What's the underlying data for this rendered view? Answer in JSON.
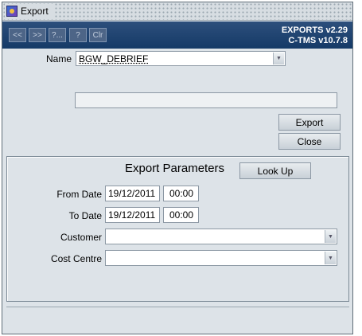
{
  "window": {
    "title": "Export"
  },
  "toolbar": {
    "buttons": [
      "<<",
      ">>",
      "?...",
      "?",
      "Clr"
    ],
    "version_line1": "EXPORTS v2.29",
    "version_line2": "C-TMS v10.7.8"
  },
  "form": {
    "name_label": "Name",
    "name_value": "BGW_DEBRIEF",
    "message_value": "",
    "export_button": "Export",
    "close_button": "Close"
  },
  "params": {
    "title": "Export Parameters",
    "lookup_button": "Look Up",
    "from_label": "From Date",
    "from_date": "19/12/2011",
    "from_time": "00:00",
    "to_label": "To Date",
    "to_date": "19/12/2011",
    "to_time": "00:00",
    "customer_label": "Customer",
    "customer_value": "",
    "cost_centre_label": "Cost Centre",
    "cost_centre_value": ""
  }
}
